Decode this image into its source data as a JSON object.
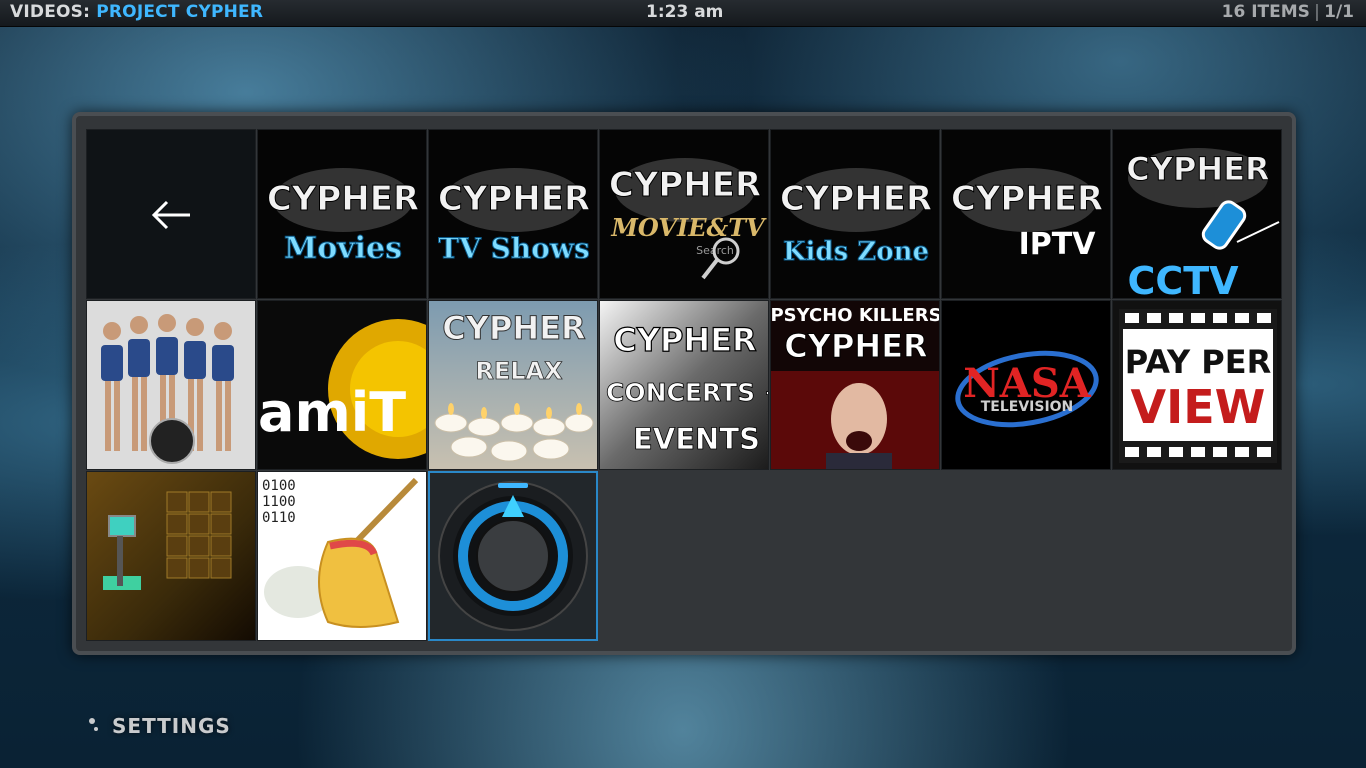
{
  "header": {
    "crumb_prefix": "VIDEOS:",
    "crumb_title": "PROJECT CYPHER",
    "clock": "1:23 am",
    "item_count": "16 ITEMS",
    "page": "1/1"
  },
  "grid": {
    "items": [
      {
        "icon": "back-arrow-icon",
        "lines": [
          "←"
        ]
      },
      {
        "lines": [
          "CYPHER",
          "Movies"
        ]
      },
      {
        "lines": [
          "CYPHER",
          "TV Shows"
        ]
      },
      {
        "lines": [
          "CYPHER",
          "MOVIE&TV",
          "Search"
        ]
      },
      {
        "lines": [
          "CYPHER",
          "Kids Zone"
        ]
      },
      {
        "lines": [
          "CYPHER",
          "IPTV"
        ]
      },
      {
        "lines": [
          "CYPHER",
          "CCTV"
        ]
      },
      {
        "lines": [],
        "icon": "group-photo"
      },
      {
        "lines": [
          "amiT"
        ]
      },
      {
        "lines": [
          "CYPHER",
          "RELAX"
        ]
      },
      {
        "lines": [
          "CYPHER",
          "CONCERTS +",
          "EVENTS"
        ]
      },
      {
        "lines": [
          "PSYCHO KILLERS",
          "CYPHER"
        ]
      },
      {
        "lines": [
          "NASA",
          "TELEVISION"
        ]
      },
      {
        "lines": [
          "PAY PER",
          "VIEW"
        ]
      },
      {
        "lines": [],
        "icon": "vault-scene"
      },
      {
        "lines": [
          "0100",
          "1100",
          "0110"
        ],
        "icon": "broom-icon"
      },
      {
        "lines": [],
        "icon": "dial-icon"
      }
    ]
  },
  "footer": {
    "settings_label": "SETTINGS"
  },
  "colors": {
    "accent_blue": "#3fb7ff",
    "panel_bg": "#333639",
    "selected_border": "#2a88c8"
  }
}
